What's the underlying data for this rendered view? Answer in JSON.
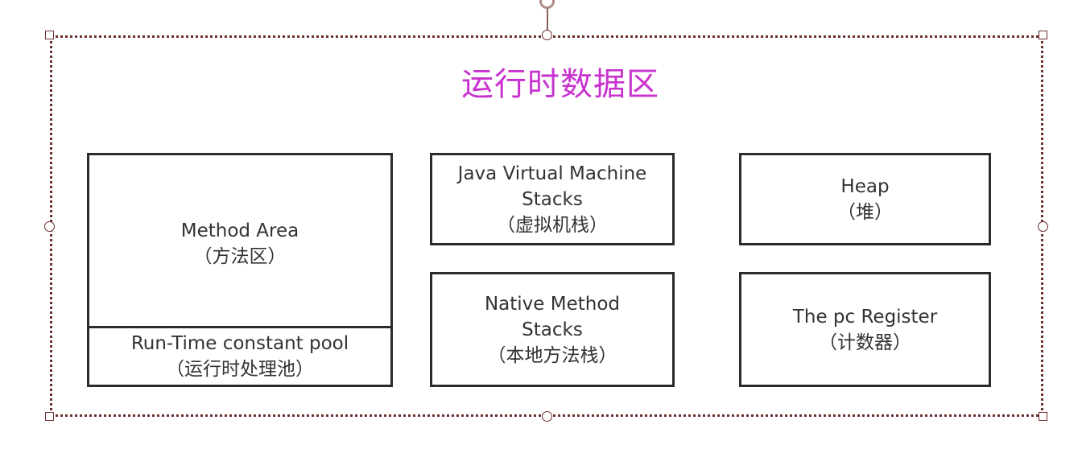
{
  "title": "运行时数据区",
  "colors": {
    "title": "#c833cf",
    "box_border": "#2b2b2b",
    "selection_frame": "#6b2e2e"
  },
  "method_area": {
    "label": "Method Area",
    "sub": "（方法区）"
  },
  "runtime_pool": {
    "label": "Run-Time constant pool",
    "sub": "（运行时处理池）"
  },
  "jvm_stacks": {
    "line1": "Java Virtual Machine",
    "line2": "Stacks",
    "sub": "（虚拟机栈）"
  },
  "native_stacks": {
    "line1": "Native Method",
    "line2": "Stacks",
    "sub": "（本地方法栈）"
  },
  "heap": {
    "label": "Heap",
    "sub": "（堆）"
  },
  "pc_register": {
    "label": "The pc Register",
    "sub": "（计数器）"
  }
}
